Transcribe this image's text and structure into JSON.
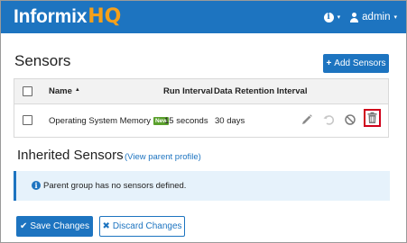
{
  "navbar": {
    "brand_main": "Informix",
    "brand_accent": "HQ",
    "info_glyph": "i",
    "caret": "▾",
    "user_name": "admin"
  },
  "sensors": {
    "title": "Sensors",
    "add_button": "Add Sensors",
    "add_glyph": "+",
    "columns": {
      "name": "Name",
      "sort_glyph": "▲",
      "run_interval": "Run Interval",
      "retention": "Data Retention Interval"
    },
    "rows": [
      {
        "name": "Operating System Memory",
        "badge": "New",
        "run_interval": "15 seconds",
        "retention": "30 days"
      }
    ]
  },
  "inherited": {
    "title": "Inherited Sensors",
    "link": "(View parent profile)",
    "alert_glyph": "i",
    "alert_text": "Parent group has no sensors defined."
  },
  "footer": {
    "save": "Save Changes",
    "save_glyph": "✔",
    "discard": "Discard Changes",
    "discard_glyph": "✖"
  },
  "colors": {
    "primary": "#1d74c0",
    "accent_brand": "#f5a01a",
    "badge_new": "#5aa02c",
    "highlight_delete": "#d0021b"
  },
  "icons": [
    "info-icon",
    "user-icon",
    "edit-icon",
    "undo-icon",
    "disable-icon",
    "trash-icon",
    "check-icon",
    "close-icon"
  ]
}
